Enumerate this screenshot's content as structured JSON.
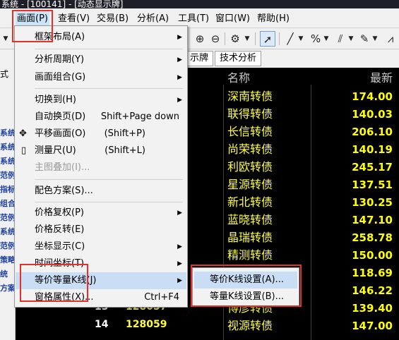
{
  "window": {
    "title": "系统 - [100141] - [动态显示牌]"
  },
  "menubar": {
    "items": [
      "画面(P)",
      "查看(V)",
      "交易(B)",
      "分析(A)",
      "工具(T)",
      "窗口(W)",
      "帮助(H)"
    ]
  },
  "left_panel": {
    "top_label_1": "式",
    "top_label_2": "查",
    "side_texts": [
      "系统",
      "系统",
      "系统",
      "范例",
      "指标",
      "组合",
      "范例",
      "系统",
      "范例",
      "策略",
      "统",
      "方案"
    ]
  },
  "tabs": {
    "items": [
      "示牌",
      "技术分析"
    ]
  },
  "quote": {
    "header_name": "名称",
    "header_price": "最新",
    "rows": [
      {
        "name": "深南转债",
        "price": "174.00"
      },
      {
        "name": "联得转债",
        "price": "140.03"
      },
      {
        "name": "长信转债",
        "price": "206.10"
      },
      {
        "name": "尚荣转债",
        "price": "140.19"
      },
      {
        "name": "利欧转债",
        "price": "245.17"
      },
      {
        "name": "星源转债",
        "price": "137.51"
      },
      {
        "name": "新北转债",
        "price": "130.25"
      },
      {
        "name": "蓝晓转债",
        "price": "147.10"
      },
      {
        "name": "晶瑞转债",
        "price": "258.78"
      },
      {
        "name": "精测转债",
        "price": "150.00"
      },
      {
        "name": "",
        "price": "118.69"
      },
      {
        "name": "",
        "price": "146.22"
      },
      {
        "idx": "13",
        "code": "128057",
        "name": "博彦转债",
        "price": "139.40"
      },
      {
        "idx": "14",
        "code": "128059",
        "name": "视源转债",
        "price": "147.00"
      }
    ]
  },
  "dropdown": {
    "items": [
      {
        "label": "框架布局(A)",
        "submenu": true
      },
      {
        "label": "分析周期(Y)",
        "submenu": true
      },
      {
        "label": "画面组合(G)",
        "submenu": true
      },
      {
        "label": "切换到(H)",
        "submenu": true
      },
      {
        "label": "自动换页(D)",
        "shortcut": "Shift+Page down"
      },
      {
        "label": "平移画面(O)",
        "shortcut": "(Shift+P)"
      },
      {
        "label": "测量尺(U)",
        "shortcut": "(Shift+L)"
      },
      {
        "label": "主图叠加(I)...",
        "disabled": true
      },
      {
        "label": "配色方案(S)..."
      },
      {
        "label": "价格复权(P)",
        "submenu": true
      },
      {
        "label": "价格反转(E)"
      },
      {
        "label": "坐标显示(C)",
        "submenu": true
      },
      {
        "label": "时间坐标(T)",
        "submenu": true
      },
      {
        "label": "等价等量K线(J)",
        "submenu": true,
        "highlighted": true
      },
      {
        "label": "窗格属性(X)...",
        "shortcut": "Ctrl+F4"
      }
    ]
  },
  "submenu": {
    "items": [
      "等价K线设置(A)...",
      "等量K线设置(B)..."
    ]
  },
  "colors": {
    "highlight": "#e8302a",
    "quote_text": "#ffff00",
    "menu_hover": "#c9def5"
  }
}
